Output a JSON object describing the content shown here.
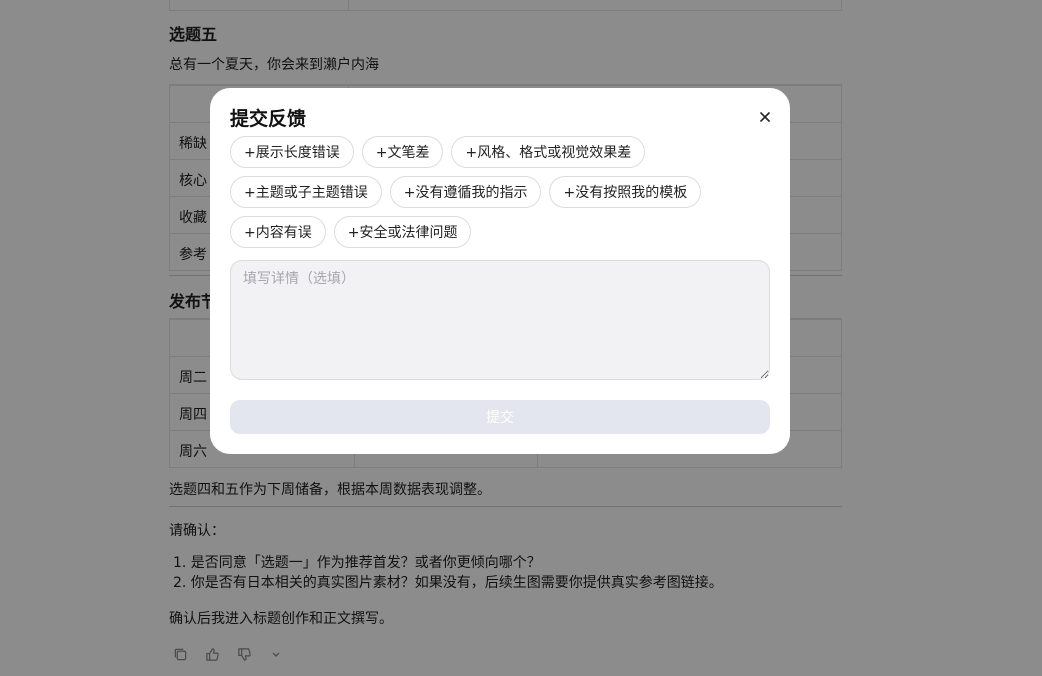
{
  "article": {
    "topic5_heading": "选题五",
    "topic5_title": "总有一个夏天，你会来到濑户内海",
    "topic5_rows": [
      "稀缺",
      "核心",
      "收藏",
      "参考"
    ],
    "schedule_heading": "发布节",
    "schedule_rows": [
      "周二",
      "周四",
      "周六"
    ],
    "schedule_note": "选题四和五作为下周储备，根据本周数据表现调整。",
    "confirm_label": "请确认：",
    "confirm_items": [
      "1. 是否同意「选题一」作为推荐首发？或者你更倾向哪个？",
      "2. 你是否有日本相关的真实图片素材？如果没有，后续生图需要你提供真实参考图链接。"
    ],
    "closing": "确认后我进入标题创作和正文撰写。"
  },
  "feedback_modal": {
    "title": "提交反馈",
    "close_icon": "close-icon",
    "chips": [
      [
        "+展示长度错误",
        "+文笔差",
        "+风格、格式或视觉效果差"
      ],
      [
        "+主题或子主题错误",
        "+没有遵循我的指示",
        "+没有按照我的模板"
      ],
      [
        "+内容有误",
        "+安全或法律问题"
      ]
    ],
    "detail_placeholder": "填写详情（选填）",
    "submit_label": "提交"
  },
  "colors": {
    "overlay": "#000000",
    "submit_disabled": "#e3e6ef",
    "chip_border": "#dcdcdc"
  }
}
